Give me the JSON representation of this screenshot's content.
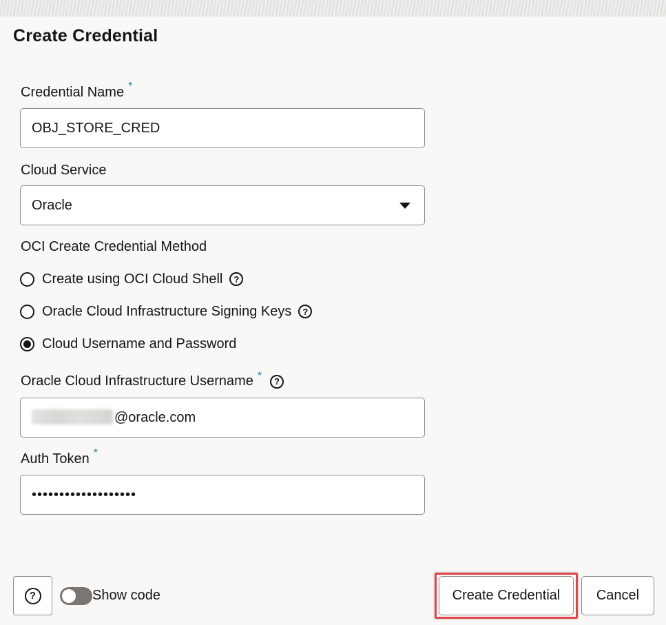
{
  "dialog": {
    "title": "Create Credential"
  },
  "fields": {
    "credential_name": {
      "label": "Credential Name",
      "required_mark": "*",
      "value": "OBJ_STORE_CRED"
    },
    "cloud_service": {
      "label": "Cloud Service",
      "value": "Oracle"
    },
    "method": {
      "label": "OCI Create Credential Method",
      "options": [
        {
          "label": "Create using OCI Cloud Shell",
          "selected": false,
          "help": "?"
        },
        {
          "label": "Oracle Cloud Infrastructure Signing Keys",
          "selected": false,
          "help": "?"
        },
        {
          "label": "Cloud Username and Password",
          "selected": true
        }
      ]
    },
    "username": {
      "label": "Oracle Cloud Infrastructure Username",
      "required_mark": "*",
      "help": "?",
      "value_suffix": "@oracle.com"
    },
    "auth_token": {
      "label": "Auth Token",
      "required_mark": "*",
      "value": "•••••••••••••••••••"
    }
  },
  "footer": {
    "help": "?",
    "show_code_label": "Show code",
    "show_code_on": false,
    "create_label": "Create Credential",
    "cancel_label": "Cancel"
  },
  "colors": {
    "required_mark": "#1f7d93",
    "highlight": "#e0464a"
  }
}
